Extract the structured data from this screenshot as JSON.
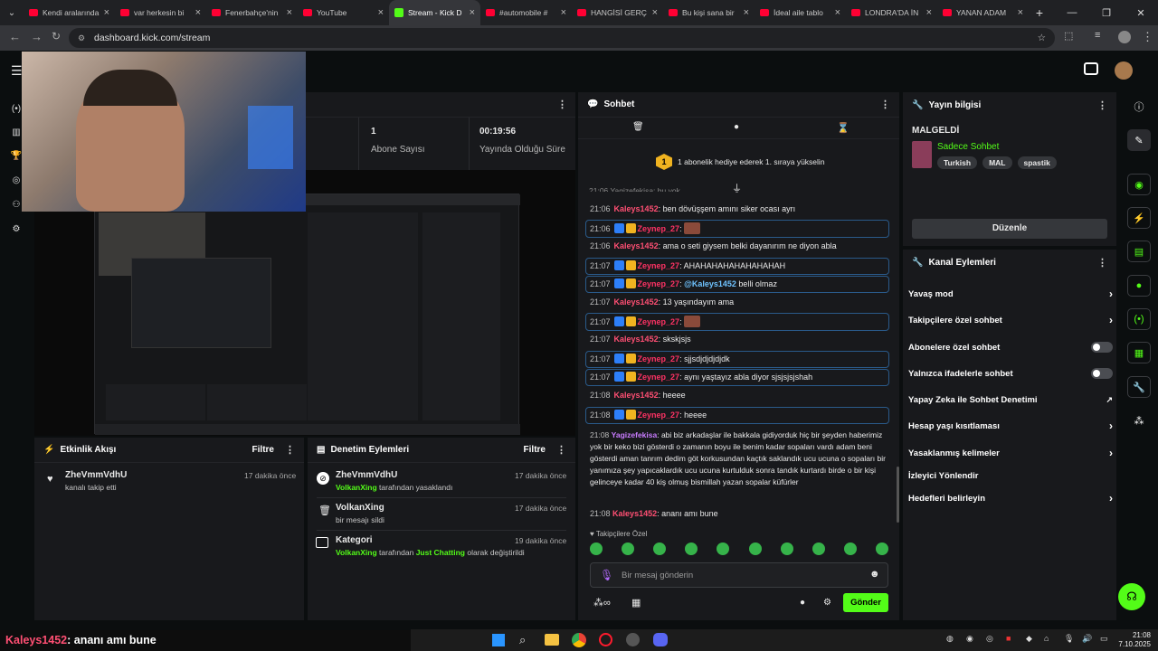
{
  "browser": {
    "tabs": [
      {
        "label": "Kendi aralarında",
        "icon": "youtube-icon",
        "active": false
      },
      {
        "label": "var herkesin bi",
        "icon": "youtube-icon",
        "active": false
      },
      {
        "label": "Fenerbahçe'nin",
        "icon": "youtube-icon",
        "active": false
      },
      {
        "label": "YouTube",
        "icon": "youtube-icon",
        "active": false
      },
      {
        "label": "Stream - Kick D",
        "icon": "kick-icon",
        "active": true
      },
      {
        "label": "#automobile #",
        "icon": "youtube-icon",
        "active": false
      },
      {
        "label": "HANGİSİ GERÇ",
        "icon": "youtube-icon",
        "active": false
      },
      {
        "label": "Bu kişi sana bir",
        "icon": "youtube-icon",
        "active": false
      },
      {
        "label": "İdeal aile tablo",
        "icon": "youtube-icon",
        "active": false
      },
      {
        "label": "LONDRA'DA İN",
        "icon": "youtube-icon",
        "active": false
      },
      {
        "label": "YANAN ADAM",
        "icon": "youtube-icon",
        "active": false
      }
    ],
    "new_tab": "+",
    "url": "dashboard.kick.com/stream"
  },
  "stats": {
    "subs_value": "1",
    "subs_label": "Abone Sayısı",
    "time_value": "00:19:56",
    "time_label": "Yayında Olduğu Süre"
  },
  "activity": {
    "title": "Etkinlik Akışı",
    "filter": "Filtre",
    "items": [
      {
        "user": "ZheVmmVdhU",
        "desc": "kanalı takip etti",
        "time": "17 dakika önce"
      }
    ]
  },
  "moderation": {
    "title": "Denetim Eylemleri",
    "filter": "Filtre",
    "items": [
      {
        "user": "ZheVmmVdhU",
        "actor": "VolkanXing",
        "desc": "tarafından yasaklandı",
        "time": "17 dakika önce"
      },
      {
        "user": "VolkanXing",
        "desc": "bir mesajı sildi",
        "time": "17 dakika önce"
      },
      {
        "user": "Kategori",
        "actor": "VolkanXing",
        "desc": "tarafından",
        "cat": "Just Chatting",
        "desc2": "olarak değiştirildi",
        "time": "19 dakika önce"
      }
    ]
  },
  "chat": {
    "title": "Sohbet",
    "goal": {
      "rank": "1",
      "text": "1 abonelik hediye ederek 1. sıraya yükselin"
    },
    "partial_top": "21:06 Yagizefekisa: bu yok",
    "messages": [
      {
        "time": "21:06",
        "user": "Kaleys1452",
        "text": "ben dövüşşem amını siker ocası ayrı"
      },
      {
        "time": "21:06",
        "user": "Zeynep_27",
        "text": ""
      },
      {
        "time": "21:06",
        "user": "Kaleys1452",
        "text": "ama o seti giysem belki dayanırım ne diyon abla"
      },
      {
        "time": "21:07",
        "user": "Zeynep_27",
        "text": "AHAHAHAHAHAHAHAHAH"
      },
      {
        "time": "21:07",
        "user": "Zeynep_27",
        "mention": "@Kaleys1452",
        "text": "belli olmaz"
      },
      {
        "time": "21:07",
        "user": "Kaleys1452",
        "text": "13 yaşındayım ama"
      },
      {
        "time": "21:07",
        "user": "Zeynep_27",
        "text": ""
      },
      {
        "time": "21:07",
        "user": "Kaleys1452",
        "text": "skskjsjs"
      },
      {
        "time": "21:07",
        "user": "Zeynep_27",
        "text": "sjjsdjdjdjdjdk"
      },
      {
        "time": "21:07",
        "user": "Zeynep_27",
        "text": "aynı yaştayız abla diyor sjsjsjsjshah"
      },
      {
        "time": "21:08",
        "user": "Kaleys1452",
        "text": "heeee"
      },
      {
        "time": "21:08",
        "user": "Zeynep_27",
        "text": "heeee"
      }
    ],
    "long_msg": {
      "time": "21:08",
      "user": "Yagizefekisa",
      "text": "abi biz arkadaşlar ile bakkala gidiyorduk hiç bir şeyden haberimiz yok bir keko bizi gösterdi o zamanın boyu ile benim kadar sopaları vardı adam beni gösterdi aman tanrım dedim göt korkusundan kaçtık saklandık ucu ucuna o sopaları bir yanımıza şey yapıcaklardık ucu ucuna kurtulduk sonra tandık kurtardı birde o bir kişi gelinceye kadar 40 kiş olmuş bismillah yazan sopalar küfürler"
    },
    "last_msg": {
      "time": "21:08",
      "user": "Kaleys1452",
      "text": "ananı amı bune"
    },
    "followers_only": "Takipçilere Özel",
    "input_placeholder": "Bir mesaj gönderin",
    "send": "Gönder"
  },
  "stream_info": {
    "title": "Yayın bilgisi",
    "stream_title": "MALGELDİ",
    "category": "Sadece Sohbet",
    "tags": [
      "Turkish",
      "MAL",
      "spastik"
    ],
    "edit": "Düzenle"
  },
  "channel_actions": {
    "title": "Kanal Eylemleri",
    "items": [
      {
        "label": "Yavaş mod",
        "control": "chevron"
      },
      {
        "label": "Takipçilere özel sohbet",
        "control": "chevron"
      },
      {
        "label": "Abonelere özel sohbet",
        "control": "toggle"
      },
      {
        "label": "Yalnızca ifadelerle sohbet",
        "control": "toggle"
      },
      {
        "label": "Yapay Zeka ile Sohbet Denetimi",
        "control": "external"
      },
      {
        "label": "Hesap yaşı kısıtlaması",
        "control": "chevron"
      },
      {
        "label": "Yasaklanmış kelimeler",
        "control": "chevron"
      },
      {
        "label": "İzleyici Yönlendir",
        "control": "none"
      },
      {
        "label": "Hedefleri belirleyin",
        "control": "chevron"
      }
    ]
  },
  "overlay": {
    "user": "Kaleys1452",
    "text": ": ananı amı bune"
  },
  "taskbar": {
    "time": "21:08",
    "date": "7.10.2025"
  },
  "colors": {
    "accent": "#53fc18",
    "panel": "#18191c",
    "bg": "#0b0e0f"
  }
}
